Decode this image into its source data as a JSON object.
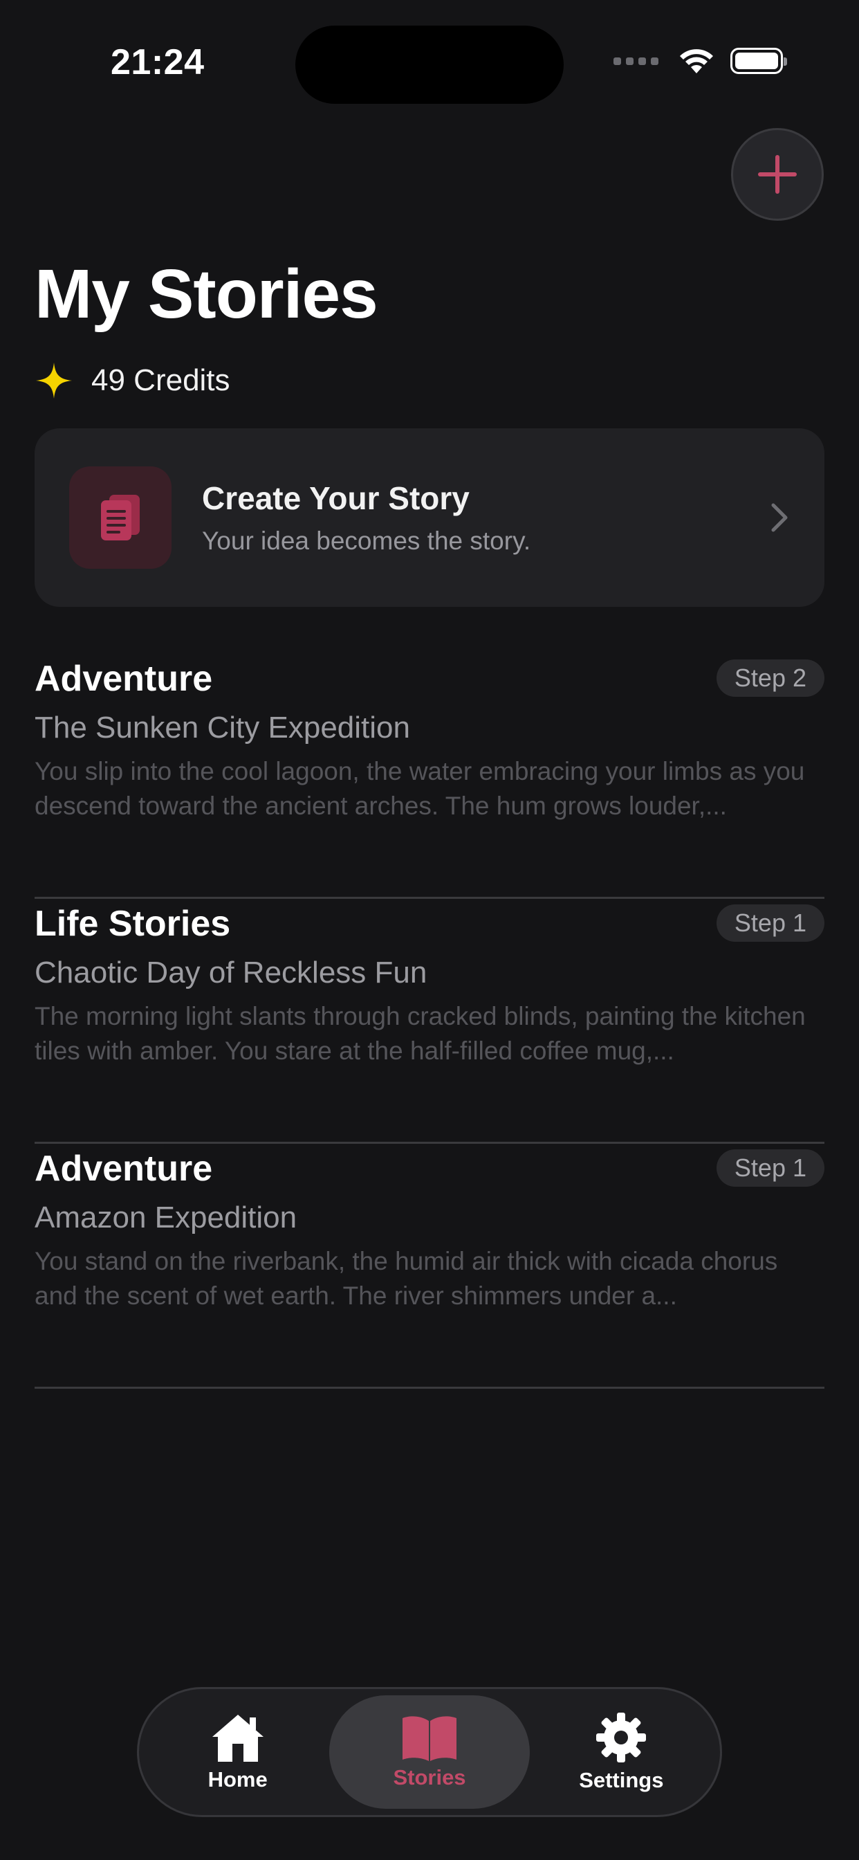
{
  "status_bar": {
    "time": "21:24",
    "signal_icon": "signal-dots-icon",
    "wifi_icon": "wifi-icon",
    "battery_icon": "battery-icon"
  },
  "header": {
    "add_icon": "plus-icon",
    "title": "My Stories",
    "credits_icon": "sparkle-icon",
    "credits_text": "49 Credits"
  },
  "create_card": {
    "icon": "document-icon",
    "title": "Create Your Story",
    "subtitle": "Your idea becomes the story.",
    "chevron_icon": "chevron-right-icon"
  },
  "stories": [
    {
      "genre": "Adventure",
      "step": "Step 2",
      "title": "The Sunken City Expedition",
      "excerpt": "You slip into the cool lagoon, the water embracing your limbs as you descend toward the ancient arches. The hum grows louder,..."
    },
    {
      "genre": "Life Stories",
      "step": "Step 1",
      "title": "Chaotic Day of Reckless Fun",
      "excerpt": "The morning light slants through cracked blinds, painting the kitchen tiles with amber. You stare at the half-filled coffee mug,..."
    },
    {
      "genre": "Adventure",
      "step": "Step 1",
      "title": "Amazon Expedition",
      "excerpt": "You stand on the riverbank, the humid air thick with cicada chorus and the scent of wet earth. The river shimmers under a..."
    }
  ],
  "tab_bar": {
    "tabs": [
      {
        "label": "Home",
        "icon": "house-icon",
        "active": false
      },
      {
        "label": "Stories",
        "icon": "book-icon",
        "active": true
      },
      {
        "label": "Settings",
        "icon": "gear-icon",
        "active": false
      }
    ]
  },
  "colors": {
    "background": "#141416",
    "accent": "#c24a68",
    "credits_star": "#f5d300",
    "card": "#212124"
  }
}
